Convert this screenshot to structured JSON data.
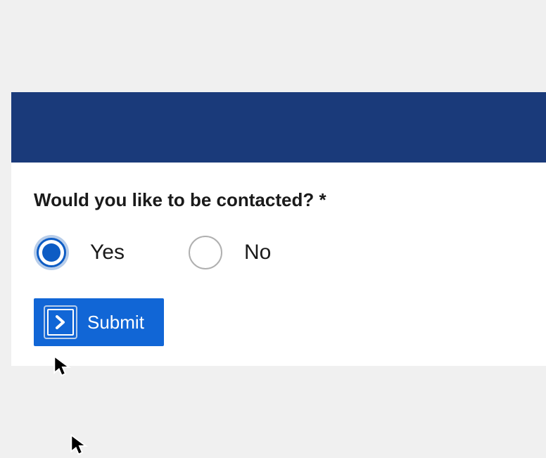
{
  "form": {
    "question": "Would you like to be contacted? *",
    "options": [
      {
        "value": "yes",
        "label": "Yes",
        "selected": true
      },
      {
        "value": "no",
        "label": "No",
        "selected": false
      }
    ],
    "submit_label": "Submit"
  }
}
